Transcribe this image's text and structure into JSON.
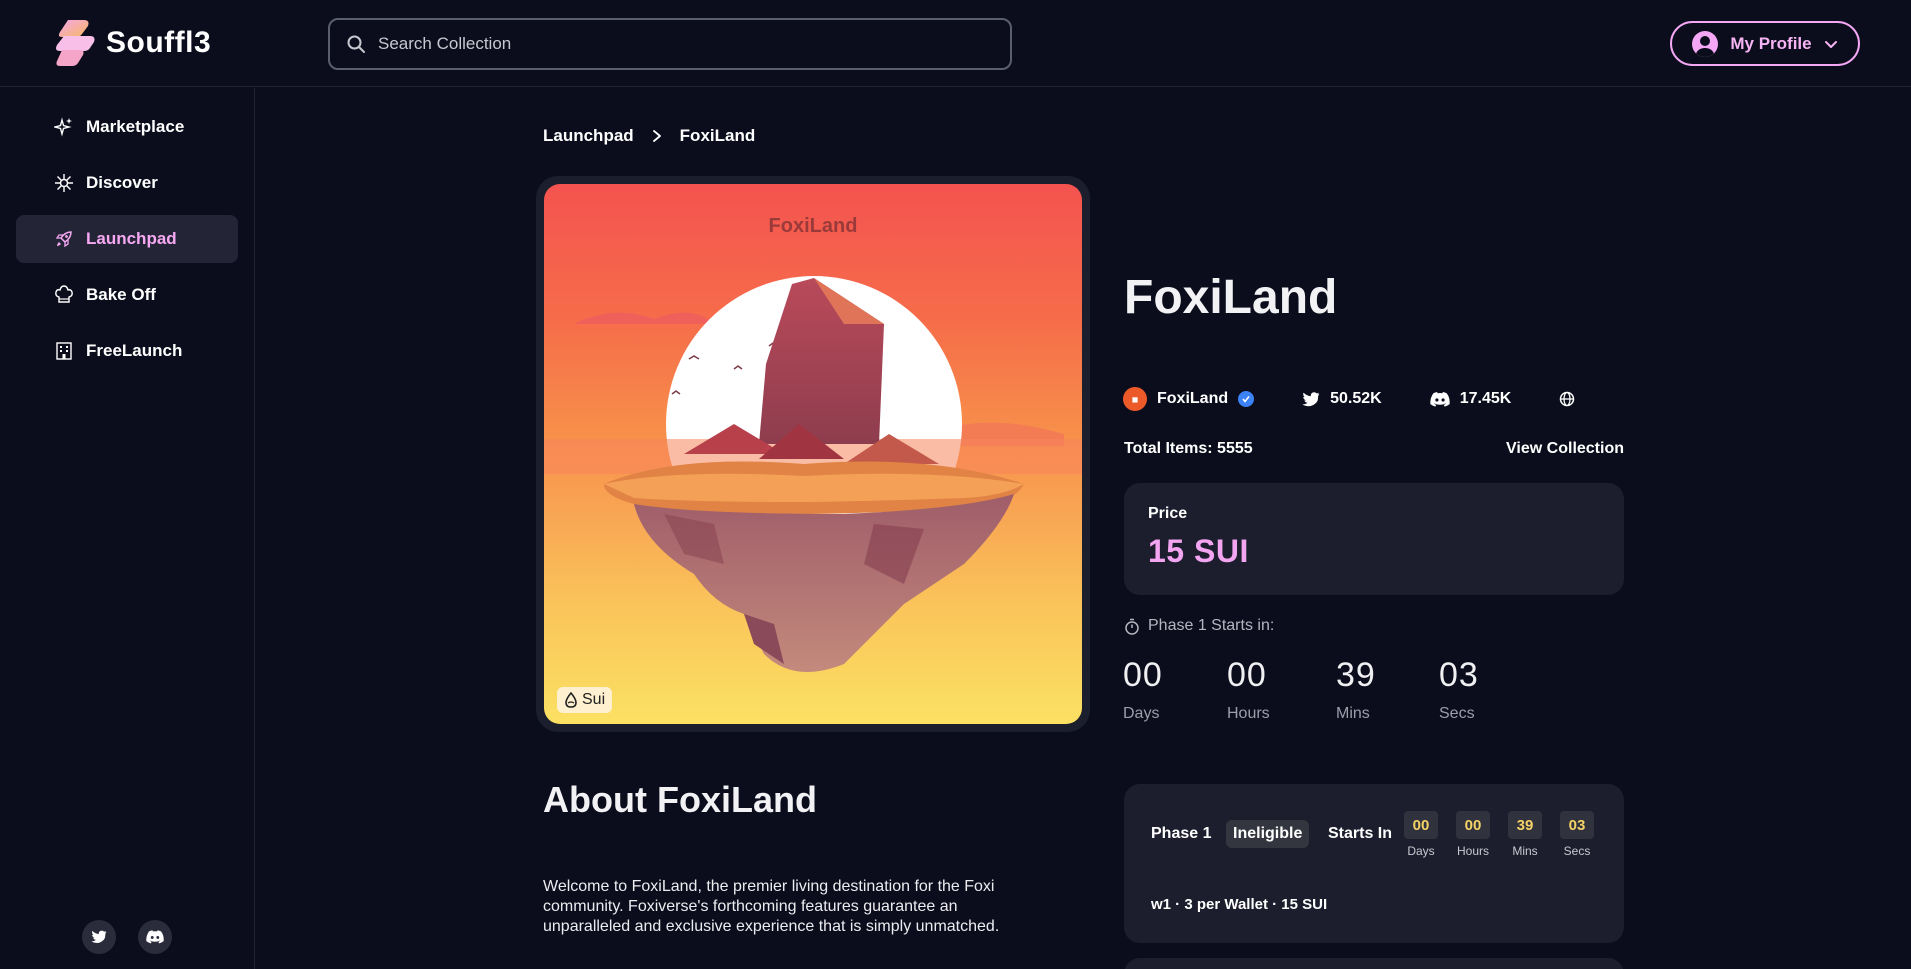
{
  "header": {
    "logo_text": "Souffl3",
    "search_placeholder": "Search Collection",
    "profile_label": "My Profile"
  },
  "sidebar": {
    "items": [
      {
        "label": "Marketplace",
        "icon": "sparkles-icon"
      },
      {
        "label": "Discover",
        "icon": "compass-icon"
      },
      {
        "label": "Launchpad",
        "icon": "rocket-icon",
        "active": true
      },
      {
        "label": "Bake Off",
        "icon": "chef-hat-icon"
      },
      {
        "label": "FreeLaunch",
        "icon": "building-icon"
      }
    ],
    "social": [
      "twitter-icon",
      "discord-icon"
    ]
  },
  "breadcrumb": {
    "parent": "Launchpad",
    "current": "FoxiLand"
  },
  "artwork": {
    "title_text": "FoxiLand",
    "chain_badge": "Sui"
  },
  "collection": {
    "title": "FoxiLand",
    "creator": "FoxiLand",
    "twitter_followers": "50.52K",
    "discord_members": "17.45K",
    "total_items": "Total Items: 5555",
    "view_collection": "View Collection"
  },
  "price": {
    "label": "Price",
    "value": "15 SUI"
  },
  "phase_start": {
    "label": "Phase 1 Starts in:",
    "countdown": [
      {
        "value": "00",
        "label": "Days"
      },
      {
        "value": "00",
        "label": "Hours"
      },
      {
        "value": "39",
        "label": "Mins"
      },
      {
        "value": "03",
        "label": "Secs"
      }
    ]
  },
  "about": {
    "title": "About FoxiLand",
    "text": "Welcome to FoxiLand, the premier living destination for the Foxi community. Foxiverse's forthcoming features guarantee an unparalleled and exclusive experience that is simply unmatched."
  },
  "phase_card": {
    "name": "Phase 1",
    "status": "Ineligible",
    "starts_in": "Starts In",
    "countdown": [
      {
        "value": "00",
        "label": "Days"
      },
      {
        "value": "00",
        "label": "Hours"
      },
      {
        "value": "39",
        "label": "Mins"
      },
      {
        "value": "03",
        "label": "Secs"
      }
    ],
    "detail": "w1 · 3 per Wallet · 15 SUI"
  },
  "colors": {
    "background": "#0b0d1c",
    "accent_pink": "#f4a5f1",
    "card": "#1c1e2d",
    "countdown_yellow": "#f4d266"
  }
}
